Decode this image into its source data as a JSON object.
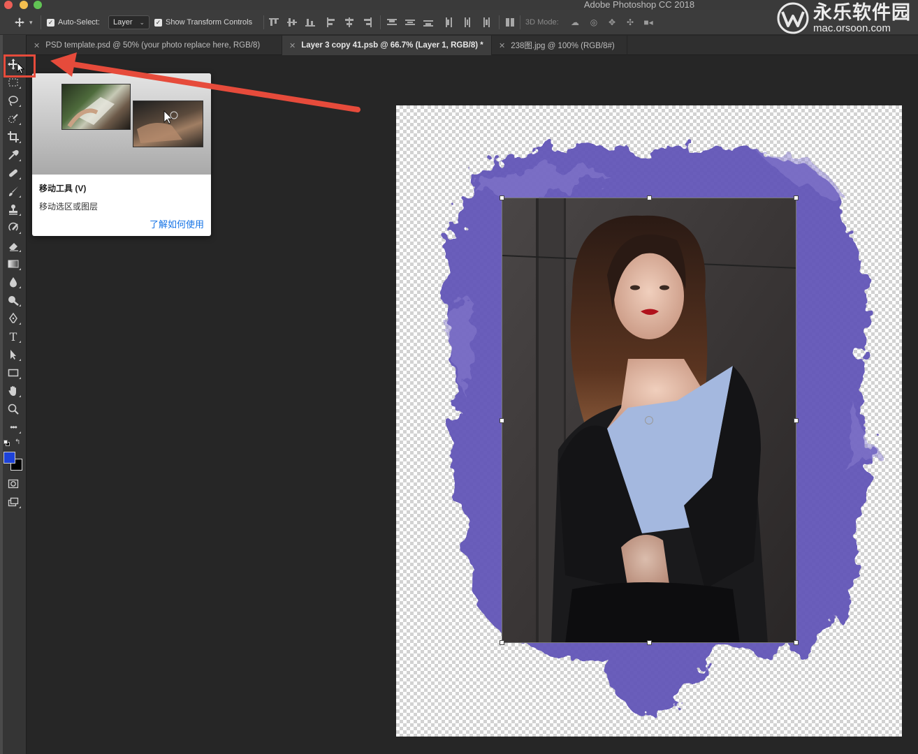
{
  "app": {
    "title": "Adobe Photoshop CC 2018"
  },
  "optionsbar": {
    "auto_select_label": "Auto-Select:",
    "auto_select_checked": true,
    "auto_select_value": "Layer",
    "show_transform_label": "Show Transform Controls",
    "show_transform_checked": true,
    "mode_3d_label": "3D Mode:"
  },
  "watermark": {
    "name": "永乐软件园",
    "url": "mac.orsoon.com"
  },
  "tabs": [
    {
      "label": "PSD template.psd @ 50% (your photo replace here, RGB/8)",
      "active": false
    },
    {
      "label": "Layer 3 copy 41.psb @ 66.7% (Layer 1, RGB/8) *",
      "active": true
    },
    {
      "label": "238图.jpg @ 100% (RGB/8#)",
      "active": false
    }
  ],
  "tooltip": {
    "title": "移动工具 (V)",
    "description": "移动选区或图层",
    "link": "了解如何使用"
  },
  "tools": [
    "move-tool-icon",
    "rectangular-marquee-icon",
    "lasso-icon",
    "quick-selection-icon",
    "crop-icon",
    "eyedropper-icon",
    "healing-brush-icon",
    "brush-icon",
    "clone-stamp-icon",
    "history-brush-icon",
    "eraser-icon",
    "gradient-icon",
    "blur-icon",
    "dodge-icon",
    "pen-icon",
    "type-icon",
    "path-selection-icon",
    "rectangle-shape-icon",
    "hand-icon",
    "zoom-icon",
    "more-tools-icon"
  ],
  "tools_type_glyph": "T",
  "colors": {
    "foreground": "#1d42d8",
    "background": "#000000",
    "brush_purple": "#6456b8",
    "highlight": "#e64b3b"
  }
}
